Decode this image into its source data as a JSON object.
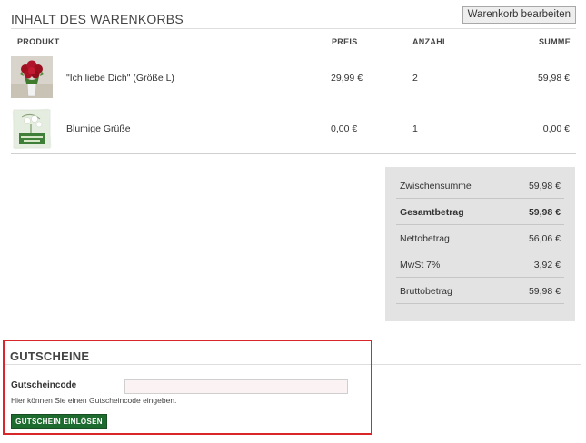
{
  "cart": {
    "title": "INHALT DES WARENKORBS",
    "edit_label": "Warenkorb bearbeiten",
    "columns": {
      "product": "PRODUKT",
      "price": "PREIS",
      "quantity": "ANZAHL",
      "total": "SUMME"
    },
    "items": [
      {
        "name": "\"Ich liebe Dich\" (Größe L)",
        "price": "29,99 €",
        "quantity": "2",
        "total": "59,98 €",
        "image": "rose-bouquet-image"
      },
      {
        "name": "Blumige Grüße",
        "price": "0,00 €",
        "quantity": "1",
        "total": "0,00 €",
        "image": "greeting-card-image"
      }
    ]
  },
  "summary": {
    "rows": [
      {
        "label": "Zwischensumme",
        "value": "59,98 €"
      },
      {
        "label": "Gesamtbetrag",
        "value": "59,98 €"
      },
      {
        "label": "Nettobetrag",
        "value": "56,06 €"
      },
      {
        "label": "MwSt 7%",
        "value": "3,92 €"
      },
      {
        "label": "Bruttobetrag",
        "value": "59,98 €"
      }
    ]
  },
  "voucher": {
    "title": "GUTSCHEINE",
    "code_label": "Gutscheincode",
    "code_value": "",
    "hint": "Hier können Sie einen Gutscheincode eingeben.",
    "redeem_label": "GUTSCHEIN EINLÖSEN"
  },
  "colors": {
    "highlight_border": "#d9262a",
    "redeem_button": "#1e6b2f",
    "summary_bg": "#e3e3e3"
  }
}
